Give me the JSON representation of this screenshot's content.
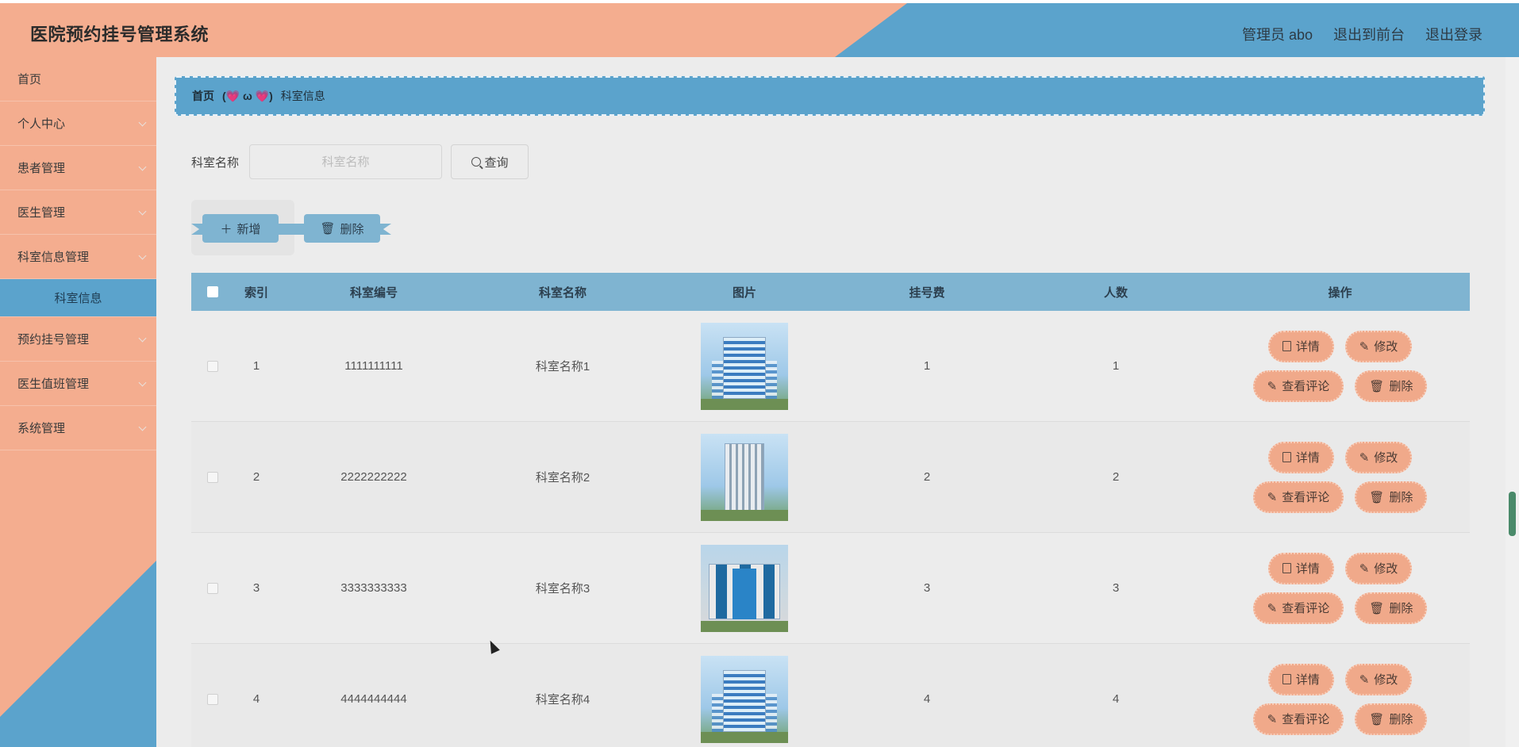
{
  "header": {
    "title": "医院预约挂号管理系统",
    "user": "管理员 abo",
    "to_front": "退出到前台",
    "logout": "退出登录"
  },
  "sidebar": {
    "items": [
      {
        "label": "首页",
        "expandable": false
      },
      {
        "label": "个人中心",
        "expandable": true
      },
      {
        "label": "患者管理",
        "expandable": true
      },
      {
        "label": "医生管理",
        "expandable": true
      },
      {
        "label": "科室信息管理",
        "expandable": true
      },
      {
        "label": "科室信息",
        "sub": true,
        "active": true
      },
      {
        "label": "预约挂号管理",
        "expandable": true
      },
      {
        "label": "医生值班管理",
        "expandable": true
      },
      {
        "label": "系统管理",
        "expandable": true
      }
    ]
  },
  "breadcrumb": {
    "home": "首页",
    "separator": "(💗 ω 💗)",
    "current": "科室信息"
  },
  "search": {
    "label": "科室名称",
    "placeholder": "科室名称",
    "value": "",
    "button": "查询"
  },
  "actions": {
    "add": "新增",
    "delete": "删除"
  },
  "table": {
    "columns": [
      "索引",
      "科室编号",
      "科室名称",
      "图片",
      "挂号费",
      "人数",
      "操作"
    ],
    "rows": [
      {
        "index": "1",
        "code": "1111111111",
        "name": "科室名称1",
        "fee": "1",
        "count": "1",
        "image": "hospital-building-a"
      },
      {
        "index": "2",
        "code": "2222222222",
        "name": "科室名称2",
        "fee": "2",
        "count": "2",
        "image": "hospital-building-b"
      },
      {
        "index": "3",
        "code": "3333333333",
        "name": "科室名称3",
        "fee": "3",
        "count": "3",
        "image": "hospital-building-c"
      },
      {
        "index": "4",
        "code": "4444444444",
        "name": "科室名称4",
        "fee": "4",
        "count": "4",
        "image": "hospital-building-a"
      }
    ],
    "ops": {
      "detail": "详情",
      "edit": "修改",
      "comments": "查看评论",
      "delete": "删除"
    }
  },
  "colors": {
    "salmon": "#f4ad8f",
    "blue": "#5ba3cc",
    "table_header": "#7fb4d1",
    "op_button": "#f0a98a"
  }
}
